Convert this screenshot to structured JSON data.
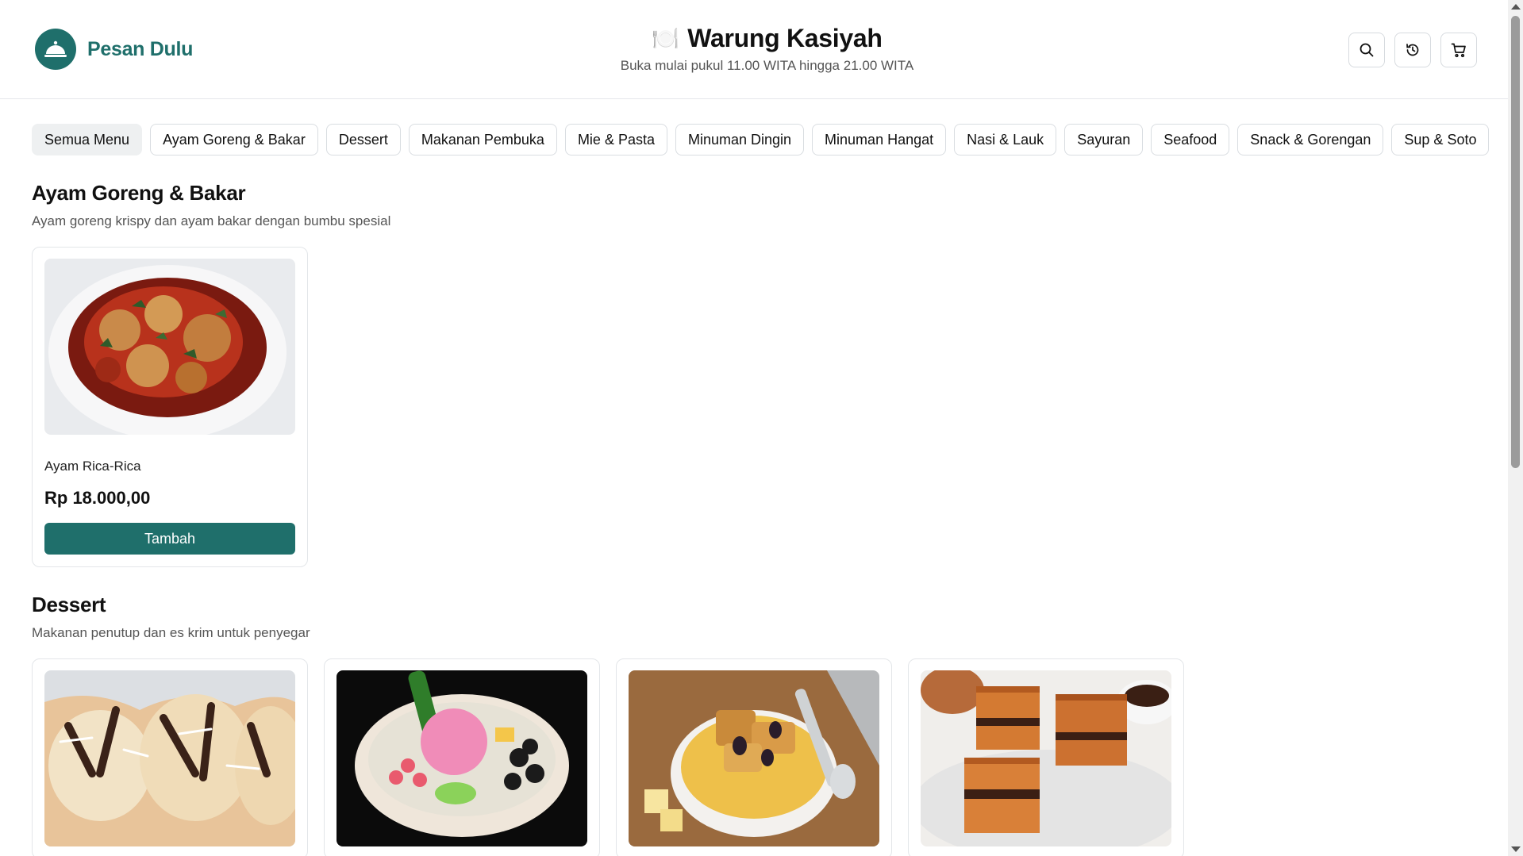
{
  "header": {
    "brand_name": "Pesan Dulu",
    "store_title": "Warung Kasiyah",
    "store_icon": "🍽️",
    "hours": "Buka mulai pukul 11.00 WITA hingga 21.00 WITA",
    "actions": [
      "search-icon",
      "history-icon",
      "cart-icon"
    ]
  },
  "tabs": [
    {
      "label": "Semua Menu",
      "active": true
    },
    {
      "label": "Ayam Goreng & Bakar"
    },
    {
      "label": "Dessert"
    },
    {
      "label": "Makanan Pembuka"
    },
    {
      "label": "Mie & Pasta"
    },
    {
      "label": "Minuman Dingin"
    },
    {
      "label": "Minuman Hangat"
    },
    {
      "label": "Nasi & Lauk"
    },
    {
      "label": "Sayuran"
    },
    {
      "label": "Seafood"
    },
    {
      "label": "Snack & Gorengan"
    },
    {
      "label": "Sup & Soto"
    }
  ],
  "sections": [
    {
      "title": "Ayam Goreng & Bakar",
      "description": "Ayam goreng krispy dan ayam bakar dengan bumbu spesial",
      "items": [
        {
          "name": "Ayam Rica-Rica",
          "price": "Rp 18.000,00",
          "button": "Tambah"
        }
      ]
    },
    {
      "title": "Dessert",
      "description": "Makanan penutup dan es krim untuk penyegar",
      "items": [
        {},
        {},
        {},
        {}
      ]
    }
  ],
  "colors": {
    "brand": "#1f6f6b",
    "border": "#e3e6e9",
    "muted_text": "#555555"
  }
}
